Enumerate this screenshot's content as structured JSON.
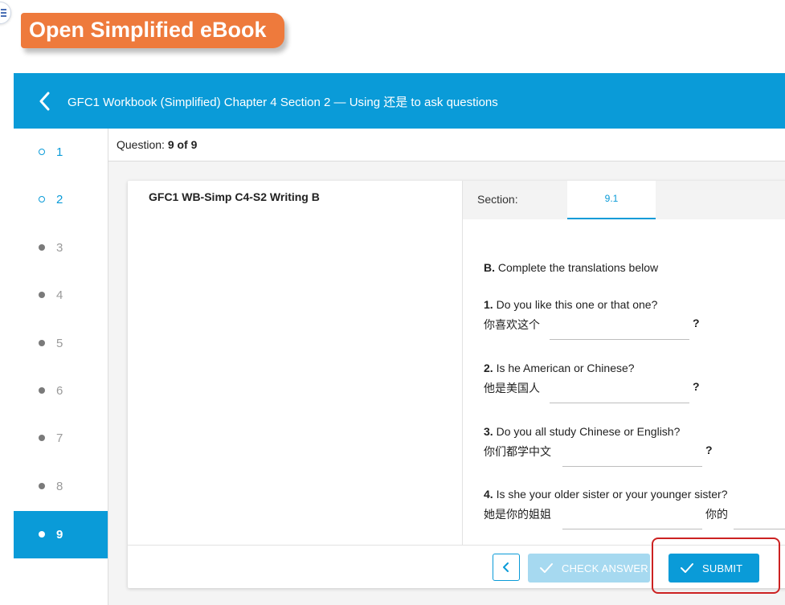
{
  "banner": {
    "text": "Open Simplified eBook"
  },
  "header": {
    "title": "GFC1 Workbook (Simplified) Chapter 4 Section 2 — Using 还是 to ask questions"
  },
  "sidebar": {
    "items": [
      {
        "label": "1",
        "state": "visited"
      },
      {
        "label": "2",
        "state": "visited"
      },
      {
        "label": "3",
        "state": "pending"
      },
      {
        "label": "4",
        "state": "pending"
      },
      {
        "label": "5",
        "state": "pending"
      },
      {
        "label": "6",
        "state": "pending"
      },
      {
        "label": "7",
        "state": "pending"
      },
      {
        "label": "8",
        "state": "pending"
      },
      {
        "label": "9",
        "state": "active"
      }
    ]
  },
  "question_bar": {
    "prefix": "Question:",
    "value": "9 of 9"
  },
  "item": {
    "title": "GFC1 WB-Simp C4-S2 Writing B"
  },
  "section_tabs": {
    "label": "Section:",
    "active_tab": "9.1"
  },
  "exercise": {
    "heading_letter": "B.",
    "heading_text": "Complete the translations below",
    "questions": [
      {
        "num": "1.",
        "english": "Do you like this one or that one?",
        "chinese": "你喜欢这个",
        "end": "?"
      },
      {
        "num": "2.",
        "english": "Is he American or Chinese?",
        "chinese": "他是美国人",
        "end": "?"
      },
      {
        "num": "3.",
        "english": "Do you all study Chinese or English?",
        "chinese": "你们都学中文",
        "end": "?"
      },
      {
        "num": "4.",
        "english": "Is she your older sister or your younger sister?",
        "chinese": "她是你的姐姐",
        "middle": "你的"
      }
    ]
  },
  "footer": {
    "check_label": "CHECK ANSWER",
    "submit_label": "SUBMIT"
  },
  "colors": {
    "primary": "#0a9bd8",
    "banner": "#ee7a3c",
    "highlight": "#cc2222",
    "disabled": "#a6d9f0"
  },
  "icons": {
    "menu": "hamburger-icon",
    "back": "chevron-left-icon",
    "check": "checkmark-icon"
  }
}
